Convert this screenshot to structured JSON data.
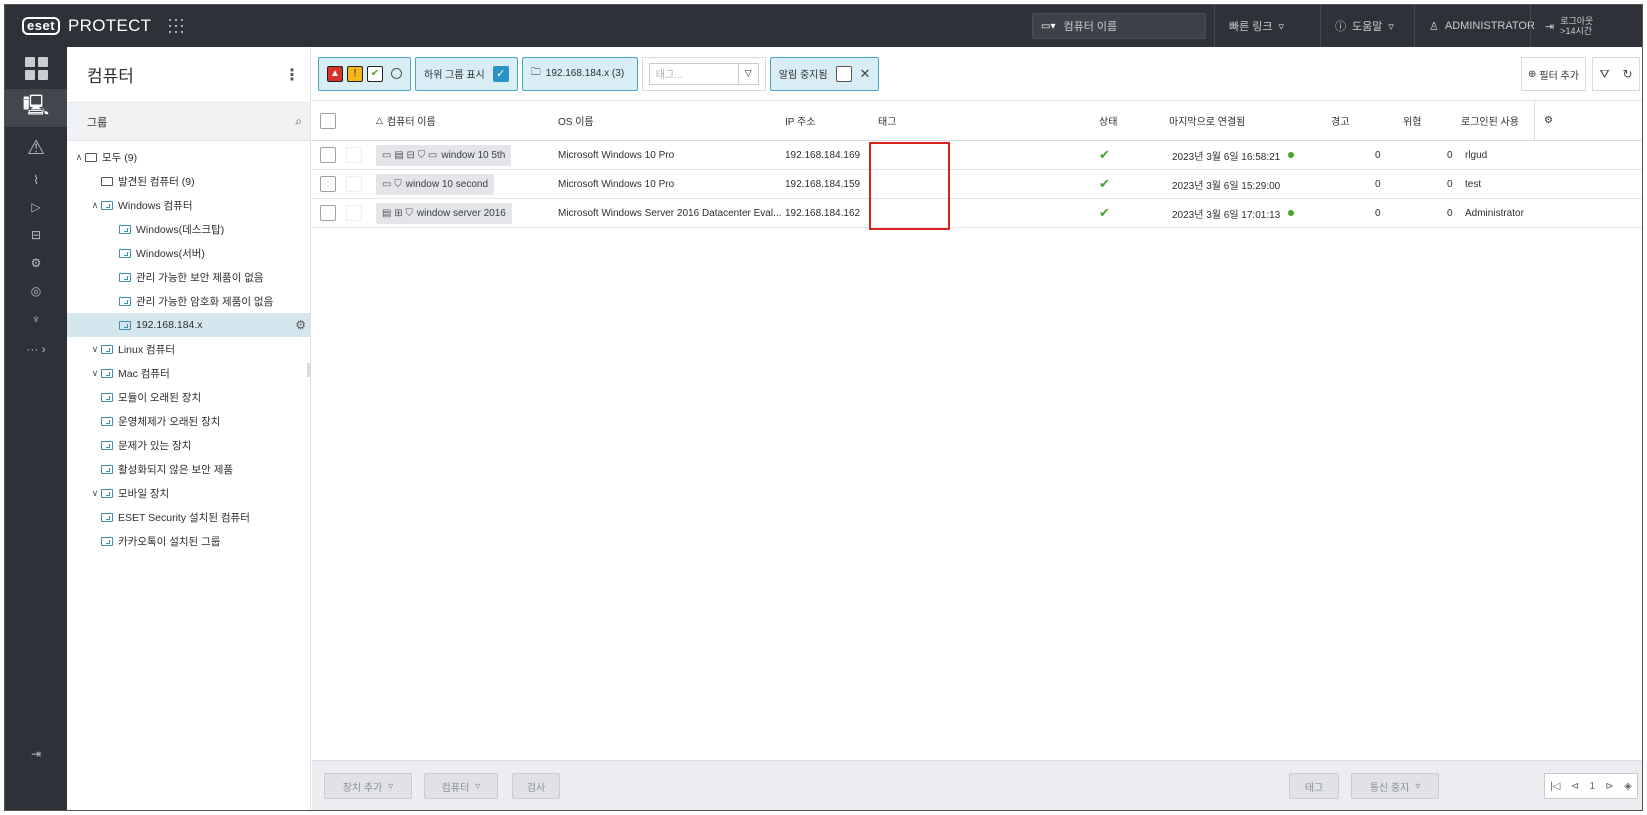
{
  "topbar": {
    "logo": "eset",
    "product": "PROTECT",
    "search_placeholder": "컴퓨터 이름",
    "quick_links": "빠른 링크",
    "help": "도움말",
    "user": "ADMINISTRATOR",
    "logout": "로그아웃",
    "logout_sub": ">14시간"
  },
  "group_panel": {
    "title": "컴퓨터",
    "sub_title": "그룹",
    "tree": [
      {
        "label": "모두 (9)",
        "level": 0,
        "caret": "^",
        "dynamic": false
      },
      {
        "label": "발견된 컴퓨터 (9)",
        "level": 1,
        "caret": "",
        "dynamic": false
      },
      {
        "label": "Windows 컴퓨터",
        "level": 1,
        "caret": "^",
        "dynamic": true
      },
      {
        "label": "Windows(데스크탑)",
        "level": 2,
        "caret": "",
        "dynamic": true
      },
      {
        "label": "Windows(서버)",
        "level": 2,
        "caret": "",
        "dynamic": true
      },
      {
        "label": "관리 가능한 보안 제품이 없음",
        "level": 2,
        "caret": "",
        "dynamic": true
      },
      {
        "label": "관리 가능한 암호화 제품이 없음",
        "level": 2,
        "caret": "",
        "dynamic": true
      },
      {
        "label": "192.168.184.x",
        "level": 2,
        "caret": "",
        "dynamic": true,
        "selected": true
      },
      {
        "label": "Linux 컴퓨터",
        "level": 1,
        "caret": "v",
        "dynamic": true
      },
      {
        "label": "Mac 컴퓨터",
        "level": 1,
        "caret": "v",
        "dynamic": true
      },
      {
        "label": "모듈이 오래된 장치",
        "level": 1,
        "caret": "",
        "dynamic": true
      },
      {
        "label": "운영체제가 오래된 장치",
        "level": 1,
        "caret": "",
        "dynamic": true
      },
      {
        "label": "문제가 있는 장치",
        "level": 1,
        "caret": "",
        "dynamic": true
      },
      {
        "label": "활성화되지 않은 보안 제품",
        "level": 1,
        "caret": "",
        "dynamic": true
      },
      {
        "label": "모바일 장치",
        "level": 1,
        "caret": "v",
        "dynamic": true
      },
      {
        "label": "ESET Security 설치된 컴퓨터",
        "level": 1,
        "caret": "",
        "dynamic": true
      },
      {
        "label": "카카오톡이 설치된 그룹",
        "level": 1,
        "caret": "",
        "dynamic": true
      }
    ]
  },
  "filters": {
    "show_subgroups": "하위 그룹 표시",
    "group_chip": "192.168.184.x (3)",
    "tag_placeholder": "태그...",
    "muted": "알림 중지됨",
    "add_filter": "필터 추가"
  },
  "table": {
    "headers": {
      "name": "컴퓨터 이름",
      "os": "OS 이름",
      "ip": "IP 주소",
      "tags": "태그",
      "status": "상태",
      "last_connected": "마지막으로 연결됨",
      "warnings": "경고",
      "threats": "위협",
      "logged_user": "로그인된 사용"
    },
    "rows": [
      {
        "name": "window 10 5th",
        "os": "Microsoft Windows 10 Pro",
        "ip": "192.168.184.169",
        "status": "✔",
        "last": "2023년 3월 6일 16:58:21",
        "online": true,
        "warn": "0",
        "threat": "0",
        "user": "rlgud",
        "icons": "▭ ▤ ⊟ ⛉ ▭"
      },
      {
        "name": "window 10 second",
        "os": "Microsoft Windows 10 Pro",
        "ip": "192.168.184.159",
        "status": "✔",
        "last": "2023년 3월 6일 15:29:00",
        "online": false,
        "warn": "0",
        "threat": "0",
        "user": "test",
        "icons": "▭ ⛉"
      },
      {
        "name": "window server 2016",
        "os": "Microsoft Windows Server 2016 Datacenter Eval...",
        "ip": "192.168.184.162",
        "status": "✔",
        "last": "2023년 3월 6일 17:01:13",
        "online": true,
        "warn": "0",
        "threat": "0",
        "user": "Administrator",
        "icons": "▤ ⊞ ⛉"
      }
    ]
  },
  "footer": {
    "add_device": "장치 추가",
    "computer": "컴퓨터",
    "scan": "검사",
    "tag": "태그",
    "mute": "통신 중지",
    "page": "1"
  },
  "colors": {
    "accent": "#2a93c6",
    "chip_bg": "#d9edf5",
    "highlight": "#d8221b",
    "ok": "#4aa32c",
    "dark": "#2e3238"
  }
}
